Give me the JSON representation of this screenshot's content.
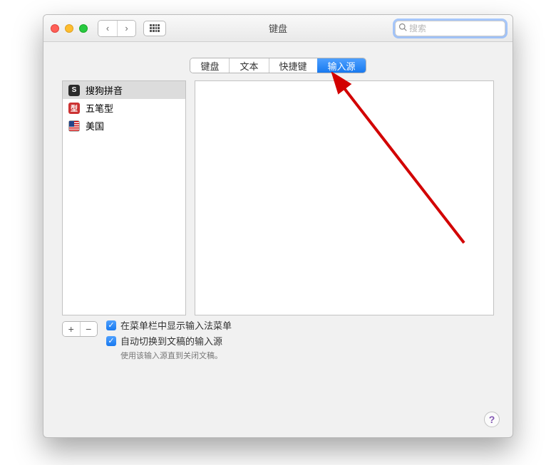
{
  "window": {
    "title": "键盘",
    "search_placeholder": "搜索"
  },
  "tabs": [
    {
      "label": "键盘"
    },
    {
      "label": "文本"
    },
    {
      "label": "快捷键"
    },
    {
      "label": "输入源"
    }
  ],
  "active_tab_index": 3,
  "sources": [
    {
      "label": "搜狗拼音",
      "icon_name": "sogou-icon",
      "icon_text": "S",
      "icon_class": "sogou",
      "selected": true
    },
    {
      "label": "五笔型",
      "icon_name": "wubi-icon",
      "icon_text": "型",
      "icon_class": "wubi",
      "selected": false
    },
    {
      "label": "美国",
      "icon_name": "us-flag-icon",
      "icon_text": "",
      "icon_class": "us",
      "selected": false
    }
  ],
  "buttons": {
    "add": "+",
    "remove": "−"
  },
  "options": {
    "show_in_menu_bar": "在菜单栏中显示输入法菜单",
    "auto_switch": "自动切换到文稿的输入源",
    "auto_switch_note": "使用该输入源直到关闭文稿。"
  },
  "help": "?"
}
